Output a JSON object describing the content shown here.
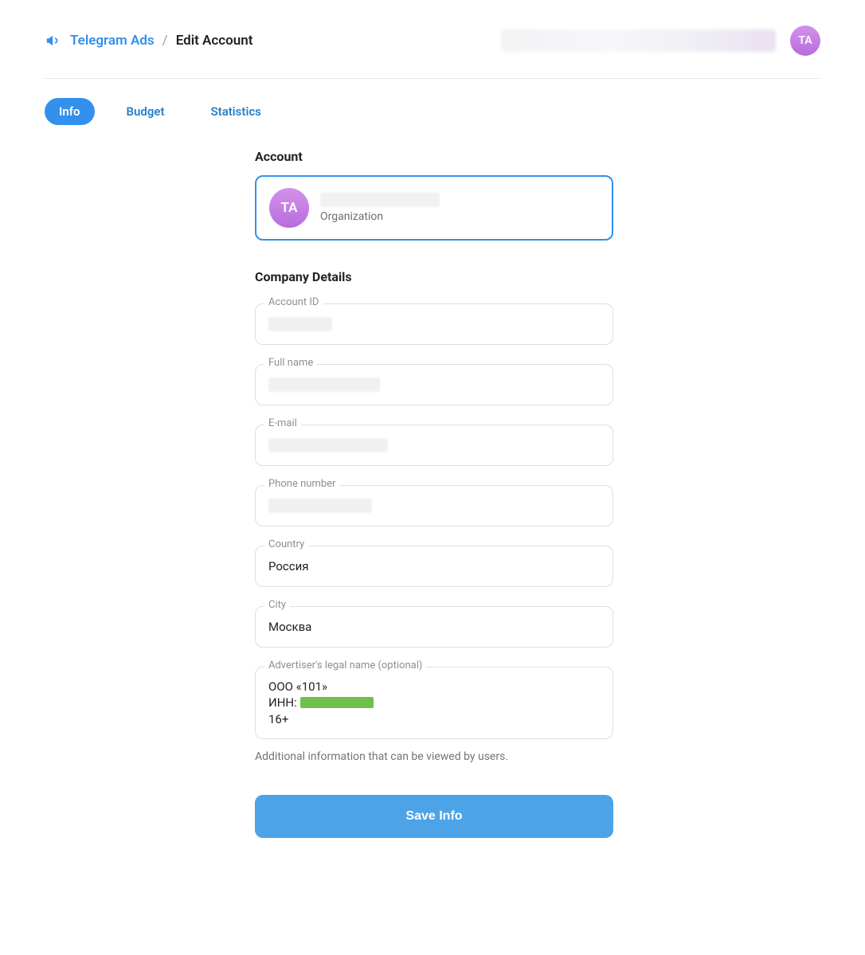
{
  "header": {
    "breadcrumb_root": "Telegram Ads",
    "breadcrumb_sep": "/",
    "breadcrumb_current": "Edit Account",
    "avatar_initials": "TA"
  },
  "tabs": [
    {
      "label": "Info",
      "active": true
    },
    {
      "label": "Budget",
      "active": false
    },
    {
      "label": "Statistics",
      "active": false
    }
  ],
  "account": {
    "section_title": "Account",
    "avatar_initials": "TA",
    "type_label": "Organization"
  },
  "company": {
    "section_title": "Company Details",
    "fields": {
      "account_id": {
        "label": "Account ID",
        "value": ""
      },
      "full_name": {
        "label": "Full name",
        "value": ""
      },
      "email": {
        "label": "E-mail",
        "value": ""
      },
      "phone": {
        "label": "Phone number",
        "value": ""
      },
      "country": {
        "label": "Country",
        "value": "Россия"
      },
      "city": {
        "label": "City",
        "value": "Москва"
      },
      "legal": {
        "label": "Advertiser's legal name (optional)",
        "line1": "ООО «101»",
        "line2_prefix": "ИНН:",
        "line3": "16+"
      }
    },
    "help_text": "Additional information that can be viewed by users."
  },
  "actions": {
    "save_label": "Save Info"
  }
}
